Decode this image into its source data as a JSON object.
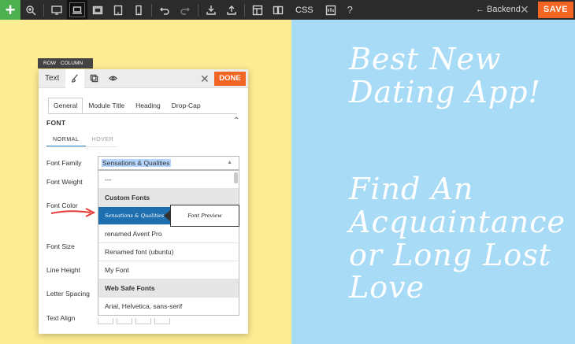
{
  "toolbar": {
    "add_label": "+",
    "css_label": "CSS",
    "help_label": "?",
    "backend_label": "← Backend",
    "close_label": "✕",
    "save_label": "SAVE",
    "icons": [
      "zoom-icon",
      "desktop-icon",
      "laptop-icon",
      "tablet-landscape-icon",
      "tablet-icon",
      "mobile-icon",
      "undo-icon",
      "redo-icon",
      "download-icon",
      "upload-icon",
      "layout-icon",
      "columns-icon",
      "code-icon",
      "help-icon"
    ]
  },
  "breadcrumb": {
    "row": "ROW",
    "column": "COLUMN"
  },
  "panel": {
    "title": "Text",
    "close_label": "✕",
    "done_label": "DONE",
    "tabs": [
      "General",
      "Module Title",
      "Heading",
      "Drop-Cap"
    ],
    "section_title": "FONT",
    "section_chevron": "⌃",
    "subtabs": [
      "NORMAL",
      "HOVER"
    ],
    "labels": {
      "font_family": "Font Family",
      "font_weight": "Font Weight",
      "font_color": "Font Color",
      "font_size": "Font Size",
      "line_height": "Line Height",
      "letter_spacing": "Letter Spacing",
      "text_align": "Text Align"
    },
    "font_family_value": "Sensations & Qualities",
    "dropdown": [
      {
        "label": "---",
        "kind": "item"
      },
      {
        "label": "Custom Fonts",
        "kind": "group"
      },
      {
        "label": "Sensations & Qualities",
        "kind": "selected"
      },
      {
        "label": "renamed Avent Pro",
        "kind": "item"
      },
      {
        "label": "Renamed font (ubuntu)",
        "kind": "item"
      },
      {
        "label": "My Font",
        "kind": "item"
      },
      {
        "label": "Web Safe Fonts",
        "kind": "group"
      },
      {
        "label": "Arial, Helvetica, sans-serif",
        "kind": "item"
      }
    ],
    "preview_label": "Font Preview"
  },
  "canvas": {
    "headline_1": "Best New\nDating App!",
    "headline_2": "Find An\nAcquaintance\nor Long Lost\nLove"
  },
  "colors": {
    "left_bg": "#fdec92",
    "right_bg": "#a8dbf5",
    "accent": "#f26522",
    "add": "#4caf50",
    "selected": "#1d6fb0",
    "annotation_arrow": "#e53935"
  }
}
